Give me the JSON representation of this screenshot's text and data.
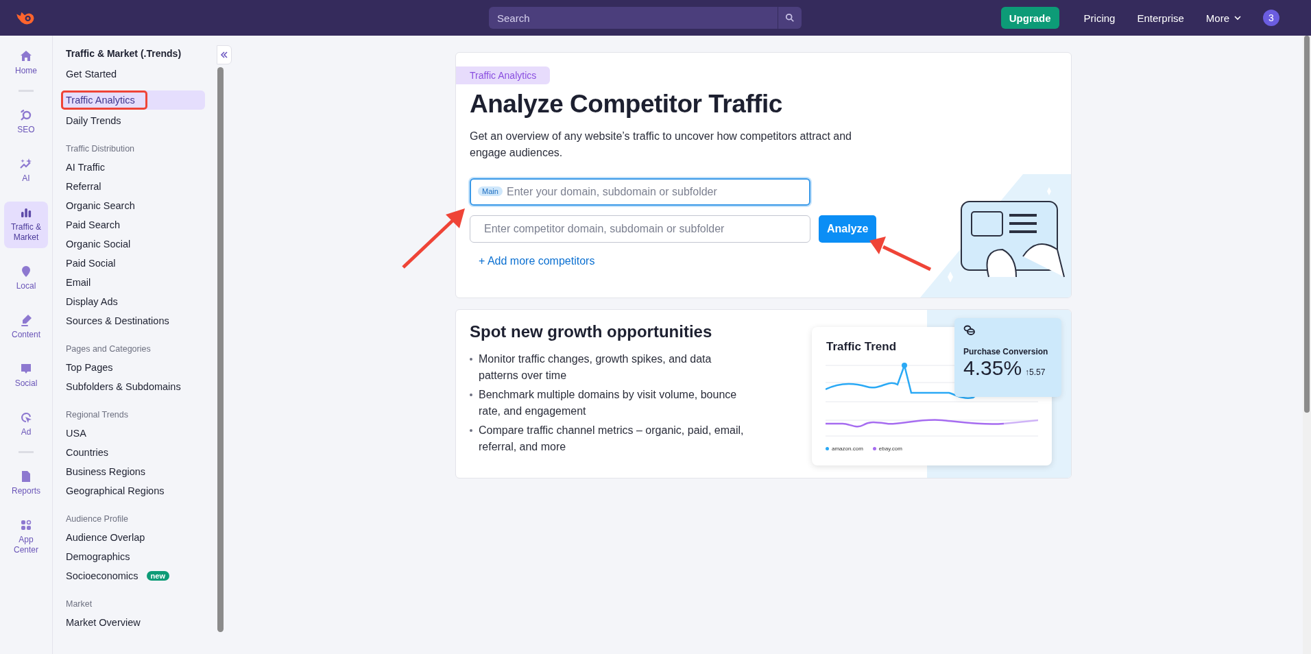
{
  "top_bar": {
    "search": {
      "placeholder": "Search"
    },
    "buttons": [
      {
        "label": "Upgrade",
        "kind": "primary"
      },
      {
        "label": "Pricing",
        "kind": "link"
      },
      {
        "label": "Enterprise",
        "kind": "link"
      },
      {
        "label": "More",
        "kind": "menu"
      }
    ],
    "notification_count": "3"
  },
  "rail": [
    {
      "label": "Home",
      "selected": false,
      "divider_after": true
    },
    {
      "label": "SEO",
      "selected": false,
      "divider_after": false
    },
    {
      "label": "AI",
      "selected": false,
      "divider_after": false
    },
    {
      "label": "Traffic & Market",
      "selected": true,
      "divider_after": false
    },
    {
      "label": "Local",
      "selected": false,
      "divider_after": false
    },
    {
      "label": "Content",
      "selected": false,
      "divider_after": false
    },
    {
      "label": "Social",
      "selected": false,
      "divider_after": false
    },
    {
      "label": "Ad",
      "selected": false,
      "divider_after": true
    },
    {
      "label": "Reports",
      "selected": false,
      "divider_after": false
    },
    {
      "label": "App Center",
      "selected": false,
      "divider_after": false
    }
  ],
  "sidebar": {
    "title": "Traffic & Market (.Trends)",
    "sections": [
      {
        "items": [
          {
            "label": "Get Started",
            "selected": false
          },
          {
            "label": "Traffic Analytics",
            "selected": true
          },
          {
            "label": "Daily Trends",
            "selected": false
          }
        ]
      },
      {
        "heading": "Traffic Distribution",
        "items": [
          {
            "label": "AI Traffic",
            "selected": false
          },
          {
            "label": "Referral",
            "selected": false
          },
          {
            "label": "Organic Search",
            "selected": false
          },
          {
            "label": "Paid Search",
            "selected": false
          },
          {
            "label": "Organic Social",
            "selected": false
          },
          {
            "label": "Paid Social",
            "selected": false
          },
          {
            "label": "Email",
            "selected": false
          },
          {
            "label": "Display Ads",
            "selected": false
          },
          {
            "label": "Sources & Destinations",
            "selected": false
          }
        ]
      },
      {
        "heading": "Pages and Categories",
        "items": [
          {
            "label": "Top Pages",
            "selected": false
          },
          {
            "label": "Subfolders & Subdomains",
            "selected": false
          }
        ]
      },
      {
        "heading": "Regional Trends",
        "items": [
          {
            "label": "USA",
            "selected": false
          },
          {
            "label": "Countries",
            "selected": false
          },
          {
            "label": "Business Regions",
            "selected": false
          },
          {
            "label": "Geographical Regions",
            "selected": false
          }
        ]
      },
      {
        "heading": "Audience Profile",
        "items": [
          {
            "label": "Audience Overlap",
            "selected": false
          },
          {
            "label": "Demographics",
            "selected": false
          },
          {
            "label": "Socioeconomics",
            "selected": false,
            "badge": "new"
          }
        ]
      },
      {
        "heading": "Market",
        "items": [
          {
            "label": "Market Overview",
            "selected": false
          }
        ]
      }
    ]
  },
  "hero": {
    "tag": "Traffic Analytics",
    "title": "Analyze Competitor Traffic",
    "description": "Get an overview of any website’s traffic to uncover how competitors attract and engage audiences.",
    "fields": [
      {
        "badge": "Main",
        "placeholder": "Enter your domain, subdomain or subfolder",
        "focused": true
      },
      {
        "placeholder": "Enter competitor domain, subdomain or subfolder",
        "focused": false
      }
    ],
    "analyze_button": "Analyze",
    "add_link": "+ Add more competitors"
  },
  "growth": {
    "title": "Spot new growth opportunities",
    "bullets": [
      "Monitor traffic changes, growth spikes, and data patterns over time",
      "Benchmark multiple domains by visit volume, bounce rate, and engagement",
      "Compare traffic channel metrics – organic, paid, email, referral, and more"
    ],
    "trend_card": {
      "title": "Traffic Trend",
      "legend": [
        {
          "label": "amazon.com",
          "color": "#2aa9f5"
        },
        {
          "label": "ebay.com",
          "color": "#a66cf0"
        }
      ]
    },
    "metric_card": {
      "label": "Purchase Conversion",
      "value": "4.35%",
      "change": "↑5.57"
    }
  }
}
